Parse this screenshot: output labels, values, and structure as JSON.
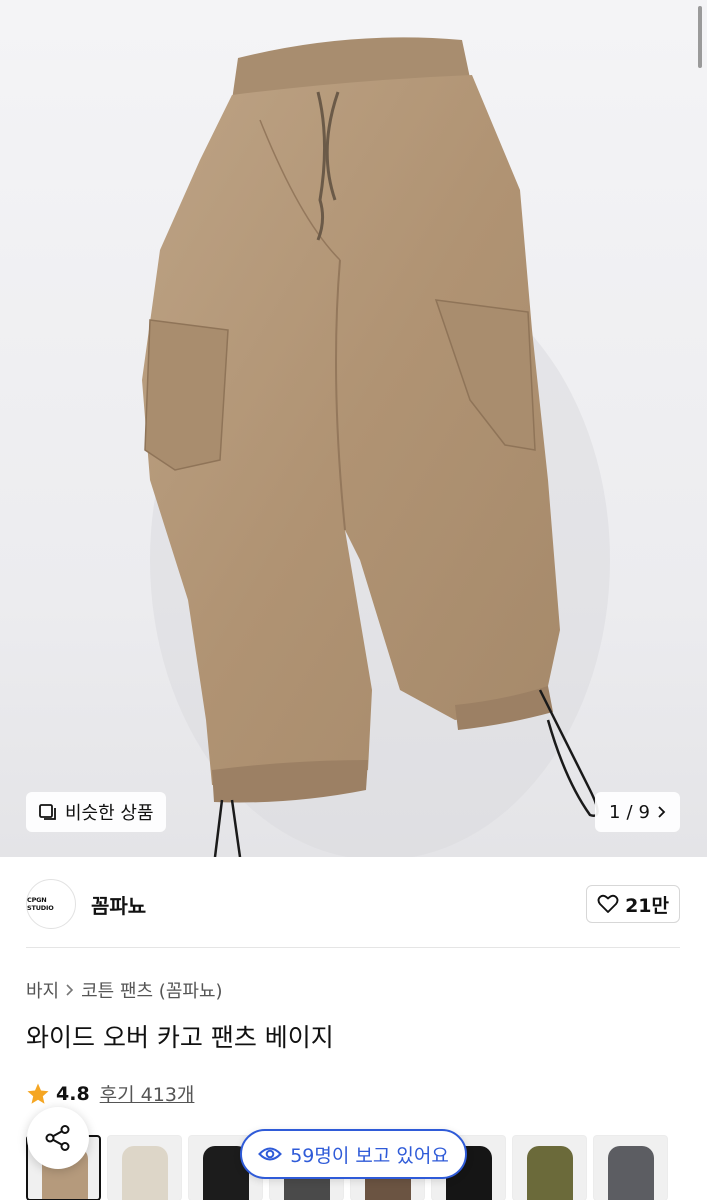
{
  "hero": {
    "similar_label": "비슷한 상품",
    "page_current": "1",
    "page_sep": "/",
    "page_total": "9",
    "product_color": "#b59a7c"
  },
  "seller": {
    "logo_text": "CPGN STUDIO",
    "name": "꼼파뇨",
    "likes": "21만"
  },
  "breadcrumb": {
    "category": "바지",
    "subcategory": "코튼 팬츠 (꼼파뇨)"
  },
  "product": {
    "title": "와이드 오버 카고 팬츠 베이지",
    "rating": "4.8",
    "reviews": "후기 413개"
  },
  "thumbnails": [
    {
      "color": "#b59a7c",
      "selected": true
    },
    {
      "color": "#ddd6c8",
      "selected": false
    },
    {
      "color": "#1c1c1c",
      "selected": false
    },
    {
      "color": "#4a4a4a",
      "selected": false
    },
    {
      "color": "#6b5442",
      "selected": false
    },
    {
      "color": "#151515",
      "selected": false
    },
    {
      "color": "#6b6a3a",
      "selected": false
    },
    {
      "color": "#5c5d62",
      "selected": false
    }
  ],
  "viewers": {
    "text": "59명이 보고 있어요"
  },
  "colors": {
    "accent_blue": "#2f5bd8",
    "star": "#f5a623"
  }
}
